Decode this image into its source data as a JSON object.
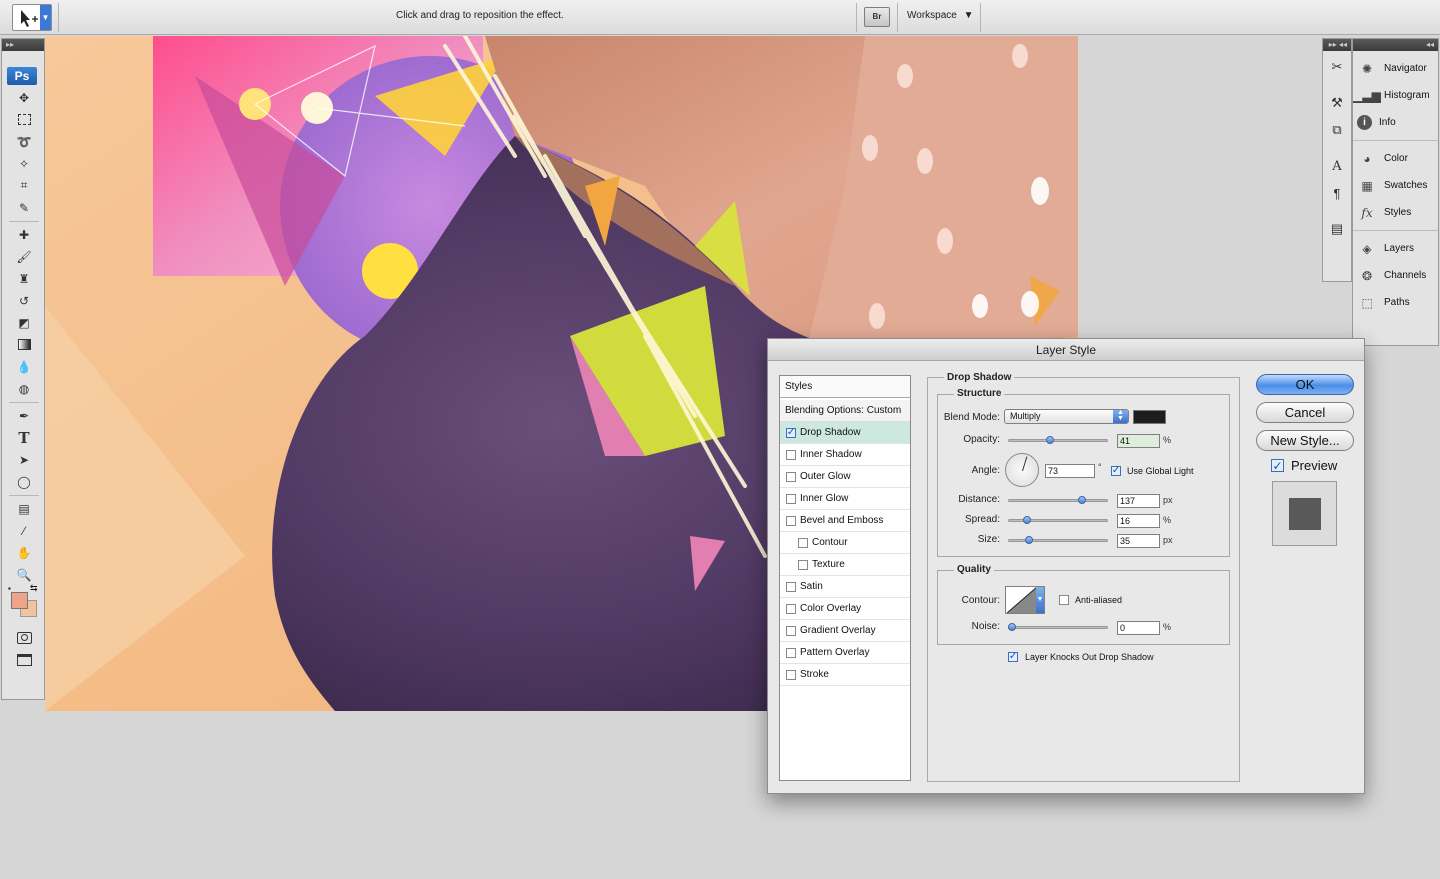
{
  "options_bar": {
    "hint": "Click and drag to reposition the effect.",
    "bridge_label": "Br",
    "workspace_label": "Workspace",
    "workspace_arrow": "▼",
    "preset_arrow": "▼"
  },
  "tools_panel": {
    "grip": "▸▸",
    "logo": "Ps"
  },
  "dock": {
    "grip_left": "▸▸ ◂◂",
    "grip_right": "◂◂",
    "panels": [
      {
        "label": "Navigator",
        "icon": "navigator-icon"
      },
      {
        "label": "Histogram",
        "icon": "histogram-icon"
      },
      {
        "label": "Info",
        "icon": "info-icon"
      },
      {
        "label": "Color",
        "icon": "color-icon"
      },
      {
        "label": "Swatches",
        "icon": "swatches-icon"
      },
      {
        "label": "Styles",
        "icon": "styles-icon"
      },
      {
        "label": "Layers",
        "icon": "layers-icon"
      },
      {
        "label": "Channels",
        "icon": "channels-icon"
      },
      {
        "label": "Paths",
        "icon": "paths-icon"
      }
    ]
  },
  "dialog": {
    "title": "Layer Style",
    "styles_header": "Styles",
    "blending_options": "Blending Options: Custom",
    "styles": [
      {
        "label": "Drop Shadow",
        "checked": true,
        "active": true,
        "sub": false
      },
      {
        "label": "Inner Shadow",
        "checked": false,
        "active": false,
        "sub": false
      },
      {
        "label": "Outer Glow",
        "checked": false,
        "active": false,
        "sub": false
      },
      {
        "label": "Inner Glow",
        "checked": false,
        "active": false,
        "sub": false
      },
      {
        "label": "Bevel and Emboss",
        "checked": false,
        "active": false,
        "sub": false
      },
      {
        "label": "Contour",
        "checked": false,
        "active": false,
        "sub": true
      },
      {
        "label": "Texture",
        "checked": false,
        "active": false,
        "sub": true
      },
      {
        "label": "Satin",
        "checked": false,
        "active": false,
        "sub": false
      },
      {
        "label": "Color Overlay",
        "checked": false,
        "active": false,
        "sub": false
      },
      {
        "label": "Gradient Overlay",
        "checked": false,
        "active": false,
        "sub": false
      },
      {
        "label": "Pattern Overlay",
        "checked": false,
        "active": false,
        "sub": false
      },
      {
        "label": "Stroke",
        "checked": false,
        "active": false,
        "sub": false
      }
    ],
    "drop_shadow": {
      "section_title": "Drop Shadow",
      "structure_title": "Structure",
      "blend_mode_label": "Blend Mode:",
      "blend_mode_value": "Multiply",
      "shadow_color": "#1e1c1c",
      "opacity_label": "Opacity:",
      "opacity_value": "41",
      "opacity_unit": "%",
      "opacity_fraction": 0.41,
      "angle_label": "Angle:",
      "angle_value": "73",
      "angle_unit": "°",
      "angle_degrees": 73,
      "use_global_light": "Use Global Light",
      "distance_label": "Distance:",
      "distance_value": "137",
      "distance_unit": "px",
      "distance_fraction": 0.76,
      "spread_label": "Spread:",
      "spread_value": "16",
      "spread_unit": "%",
      "spread_fraction": 0.16,
      "size_label": "Size:",
      "size_value": "35",
      "size_unit": "px",
      "size_fraction": 0.18,
      "quality_title": "Quality",
      "contour_label": "Contour:",
      "anti_aliased": "Anti-aliased",
      "noise_label": "Noise:",
      "noise_value": "0",
      "noise_unit": "%",
      "noise_fraction": 0,
      "knocks_out": "Layer Knocks Out Drop Shadow"
    },
    "buttons": {
      "ok": "OK",
      "cancel": "Cancel",
      "new_style": "New Style...",
      "preview": "Preview"
    },
    "preview_swatch_color": "#595959"
  }
}
